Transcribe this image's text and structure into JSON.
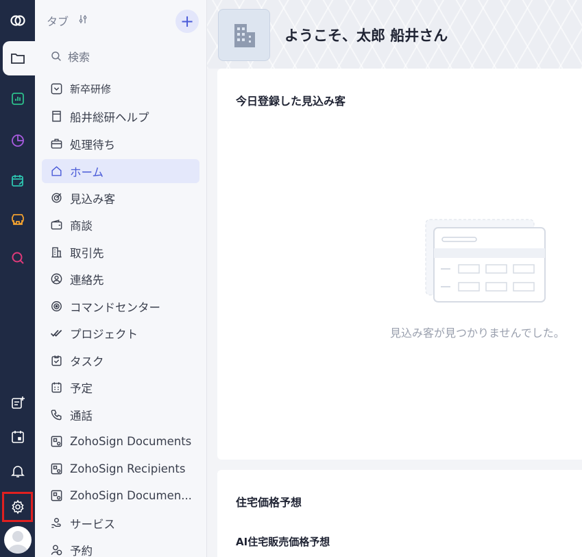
{
  "rail": {
    "icons": [
      "crm-logo-icon",
      "folder-icon",
      "analytics-icon",
      "pie-chart-icon",
      "calendar-edit-icon",
      "store-icon",
      "search-insights-icon",
      "add-note-icon",
      "calendar-icon",
      "bell-icon",
      "gear-icon",
      "user-avatar"
    ]
  },
  "nav": {
    "header_label": "タブ",
    "search_label": "検索",
    "items": [
      {
        "label": "新卒研修",
        "icon": "chevron-down-icon"
      },
      {
        "label": "船井総研ヘルプ",
        "icon": "page-icon"
      },
      {
        "label": "処理待ち",
        "icon": "briefcase-icon"
      },
      {
        "label": "ホーム",
        "icon": "home-icon",
        "active": true
      },
      {
        "label": "見込み客",
        "icon": "target-icon"
      },
      {
        "label": "商談",
        "icon": "wallet-icon"
      },
      {
        "label": "取引先",
        "icon": "building-icon"
      },
      {
        "label": "連絡先",
        "icon": "contact-icon"
      },
      {
        "label": "コマンドセンター",
        "icon": "command-center-icon"
      },
      {
        "label": "プロジェクト",
        "icon": "double-check-icon"
      },
      {
        "label": "タスク",
        "icon": "task-icon"
      },
      {
        "label": "予定",
        "icon": "calendar-icon"
      },
      {
        "label": "通話",
        "icon": "phone-icon"
      },
      {
        "label": "ZohoSign Documents",
        "icon": "sign-doc-icon"
      },
      {
        "label": "ZohoSign Recipients",
        "icon": "sign-doc-icon"
      },
      {
        "label": "ZohoSign Documen...",
        "icon": "sign-doc-icon"
      },
      {
        "label": "サービス",
        "icon": "service-icon"
      },
      {
        "label": "予約",
        "icon": "appointment-icon"
      }
    ]
  },
  "main": {
    "welcome": "ようこそ、太郎 船井さん",
    "card1_title": "今日登録した見込み客",
    "empty_message": "見込み客が見つかりませんでした。",
    "card2_title": "住宅価格予想",
    "card2_subtitle": "AI住宅販売価格予想"
  },
  "colors": {
    "rail_bg": "#1f2a44",
    "accent": "#4a5bd8",
    "active_bg": "#e4e8fb",
    "highlight_border": "#e02020"
  }
}
